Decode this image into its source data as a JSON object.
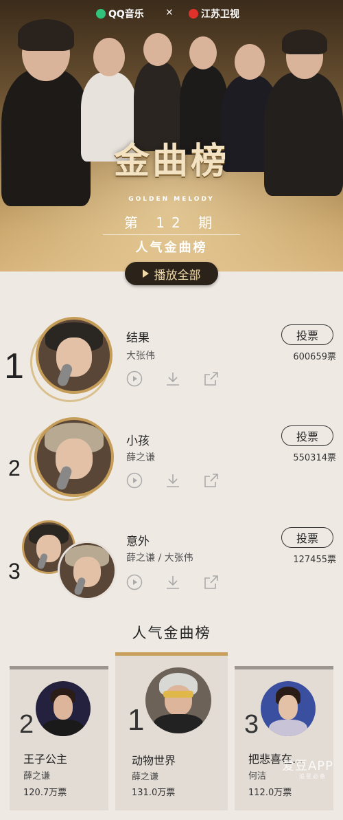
{
  "hero": {
    "brand_qq": "QQ音乐",
    "brand_cross": "×",
    "brand_tv": "江苏卫视",
    "logo_text": "金曲榜",
    "logo_sub": "GOLDEN MELODY",
    "issue": "第 12 期",
    "subtitle": "人气金曲榜",
    "play_all": "播放全部"
  },
  "songs": [
    {
      "rank": "1",
      "title": "结果",
      "artist": "大张伟",
      "vote_label": "投票",
      "votes": "600659票"
    },
    {
      "rank": "2",
      "title": "小孩",
      "artist": "薛之谦",
      "vote_label": "投票",
      "votes": "550314票"
    },
    {
      "rank": "3",
      "title": "意外",
      "artist": "薛之谦 / 大张伟",
      "vote_label": "投票",
      "votes": "127455票"
    }
  ],
  "popular": {
    "title": "人气金曲榜",
    "cards": [
      {
        "rank": "2",
        "title": "王子公主",
        "artist": "薛之谦",
        "votes": "120.7万票"
      },
      {
        "rank": "1",
        "title": "动物世界",
        "artist": "薛之谦",
        "votes": "131.0万票"
      },
      {
        "rank": "3",
        "title": "把悲喜在…",
        "artist": "何洁",
        "votes": "112.0万票"
      }
    ]
  },
  "watermark": {
    "text": "爱豆APP",
    "sub": "追星必备"
  },
  "colors": {
    "gold": "#c59d59",
    "dark_button": "#2b231a",
    "background": "#efe9e4"
  }
}
